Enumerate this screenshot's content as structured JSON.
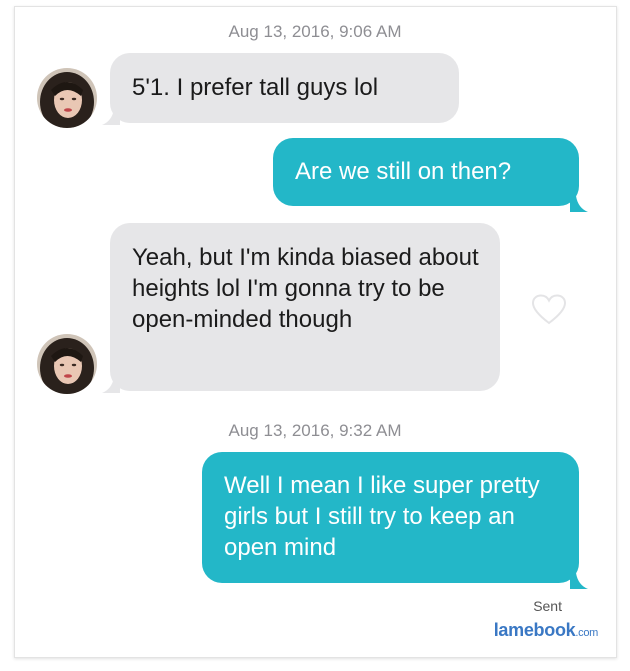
{
  "conversation": {
    "timestamps": [
      "Aug 13, 2016, 9:06 AM",
      "Aug 13, 2016, 9:32 AM"
    ],
    "messages": [
      {
        "direction": "incoming",
        "text": "5'1.  I prefer tall guys lol"
      },
      {
        "direction": "outgoing",
        "text": "Are we still on then?"
      },
      {
        "direction": "incoming",
        "text": "Yeah, but I'm kinda biased about heights lol I'm gonna try to be open-minded though"
      },
      {
        "direction": "outgoing",
        "text": "Well I mean I like super pretty girls but I still try to keep an open mind"
      }
    ],
    "delivery_status": "Sent"
  },
  "icons": {
    "like": "heart-outline-icon",
    "avatar": "contact-avatar"
  },
  "colors": {
    "incoming_bubble": "#e6e6e8",
    "outgoing_bubble": "#23b7c8",
    "timestamp": "#8e8e93",
    "watermark": "#3a78c4"
  },
  "watermark": {
    "brand": "lamebook",
    "suffix": ".com"
  }
}
